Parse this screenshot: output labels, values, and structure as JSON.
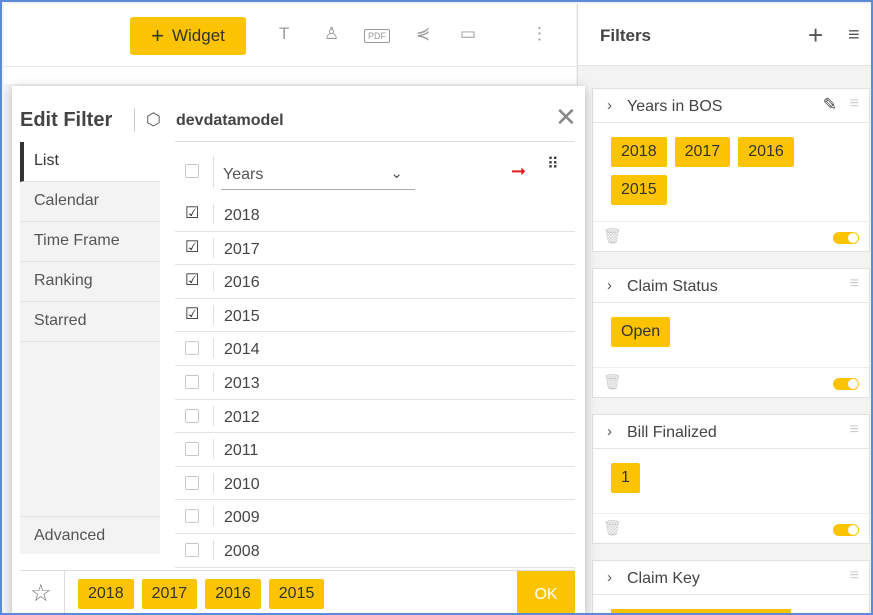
{
  "toolbar": {
    "widget_label": "Widget",
    "pdf_label": "PDF"
  },
  "filters_panel": {
    "title": "Filters",
    "cards": [
      {
        "title": "Years in BOS",
        "chips": [
          "2018",
          "2017",
          "2016",
          "2015"
        ]
      },
      {
        "title": "Claim Status",
        "chips": [
          "Open"
        ]
      },
      {
        "title": "Bill Finalized",
        "chips": [
          "1"
        ]
      },
      {
        "title": "Claim Key",
        "chips": []
      }
    ]
  },
  "modal": {
    "title": "Edit Filter",
    "datamodel": "devdatamodel",
    "nav": [
      "List",
      "Calendar",
      "Time Frame",
      "Ranking",
      "Starred"
    ],
    "nav_advanced": "Advanced",
    "dimension": "Years",
    "rows": [
      {
        "label": "2018",
        "checked": true
      },
      {
        "label": "2017",
        "checked": true
      },
      {
        "label": "2016",
        "checked": true
      },
      {
        "label": "2015",
        "checked": true
      },
      {
        "label": "2014",
        "checked": false
      },
      {
        "label": "2013",
        "checked": false
      },
      {
        "label": "2012",
        "checked": false
      },
      {
        "label": "2011",
        "checked": false
      },
      {
        "label": "2010",
        "checked": false
      },
      {
        "label": "2009",
        "checked": false
      },
      {
        "label": "2008",
        "checked": false
      }
    ],
    "selected_chips": [
      "2018",
      "2017",
      "2016",
      "2015"
    ],
    "ok_label": "OK"
  },
  "colors": {
    "accent": "#fcc400",
    "arrow": "#e41b1b",
    "frame_border": "#5b8bd8"
  }
}
